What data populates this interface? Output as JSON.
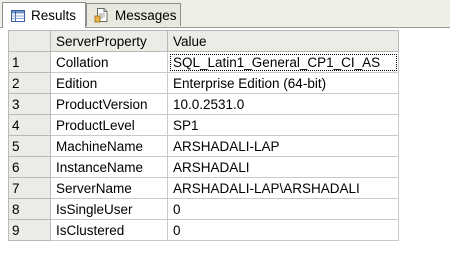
{
  "tabs": [
    {
      "label": "Results",
      "icon": "grid-icon",
      "active": true
    },
    {
      "label": "Messages",
      "icon": "document-icon",
      "active": false
    }
  ],
  "grid": {
    "columns": [
      "ServerProperty",
      "Value"
    ],
    "rows": [
      {
        "num": "1",
        "property": "Collation",
        "value": "SQL_Latin1_General_CP1_CI_AS"
      },
      {
        "num": "2",
        "property": "Edition",
        "value": "Enterprise Edition (64-bit)"
      },
      {
        "num": "3",
        "property": "ProductVersion",
        "value": "10.0.2531.0"
      },
      {
        "num": "4",
        "property": "ProductLevel",
        "value": "SP1"
      },
      {
        "num": "5",
        "property": "MachineName",
        "value": "ARSHADALI-LAP"
      },
      {
        "num": "6",
        "property": "InstanceName",
        "value": "ARSHADALI"
      },
      {
        "num": "7",
        "property": "ServerName",
        "value": "ARSHADALI-LAP\\ARSHADALI"
      },
      {
        "num": "8",
        "property": "IsSingleUser",
        "value": "0"
      },
      {
        "num": "9",
        "property": "IsClustered",
        "value": "0"
      }
    ]
  }
}
